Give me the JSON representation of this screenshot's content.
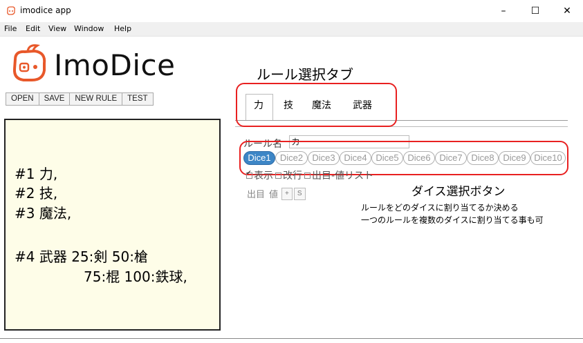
{
  "window": {
    "title": "imodice app",
    "minimize": "–",
    "maximize": "☐",
    "close": "✕"
  },
  "menu": [
    "File",
    "Edit",
    "View",
    "Window",
    "Help"
  ],
  "brand": {
    "name": "ImoDice"
  },
  "toolbar": {
    "open_label": "OPEN",
    "save_label": "SAVE",
    "new_rule_label": "NEW RULE",
    "test_label": "TEST"
  },
  "rules_text": {
    "line1": "#1 力,",
    "line2": "#2 技,",
    "line3": "#3 魔法,",
    "line4": "#4 武器 25:剣 50:槍",
    "line5": "75:棍 100:鉄球,"
  },
  "annotations": {
    "tab_title": "ルール選択タブ",
    "dice_title": "ダイス選択ボタン",
    "dice_desc1": "ルールをどのダイスに割り当てるか決める",
    "dice_desc2": "一つのルールを複数のダイスに割り当てる事も可"
  },
  "tabs": [
    "力",
    "技",
    "魔法",
    "武器"
  ],
  "rule_name": {
    "label": "ルール名",
    "value": "力"
  },
  "dice_buttons": [
    "Dice1",
    "Dice2",
    "Dice3",
    "Dice4",
    "Dice5",
    "Dice6",
    "Dice7",
    "Dice8",
    "Dice9",
    "Dice10"
  ],
  "dice_selected": "Dice1",
  "options": {
    "show": "表示",
    "newline": "改行",
    "value_list": "出目-値リスト"
  },
  "value_header": {
    "roll": "出目",
    "value": "値",
    "plus": "+",
    "s": "S"
  },
  "colors": {
    "annotation_red": "#e82020",
    "dice_active": "#3d86c6",
    "panel_bg": "#fefde8"
  }
}
